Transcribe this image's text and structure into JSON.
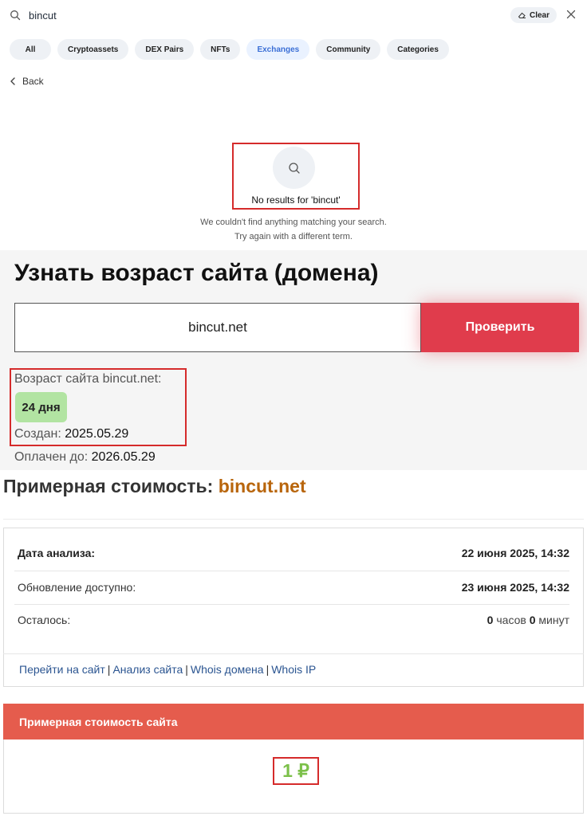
{
  "search": {
    "query": "bincut",
    "clear_label": "Clear"
  },
  "tabs": [
    {
      "label": "All"
    },
    {
      "label": "Cryptoassets"
    },
    {
      "label": "DEX Pairs"
    },
    {
      "label": "NFTs"
    },
    {
      "label": "Exchanges",
      "active": true
    },
    {
      "label": "Community"
    },
    {
      "label": "Categories"
    }
  ],
  "back_label": "Back",
  "no_results": {
    "title": "No results for 'bincut'",
    "line1": "We couldn't find anything matching your search.",
    "line2": "Try again with a different term."
  },
  "domain_age": {
    "heading": "Узнать возраст сайта (домена)",
    "input_value": "bincut.net",
    "button_label": "Проверить",
    "age_label": "Возраст сайта bincut.net:",
    "age_value": "24 дня",
    "created_label": "Создан:",
    "created_value": "2025.05.29",
    "paid_label": "Оплачен до:",
    "paid_value": "2026.05.29"
  },
  "estimate": {
    "heading_prefix": "Примерная стоимость:",
    "heading_site": "bincut.net",
    "rows": [
      {
        "label": "Дата анализа:",
        "value": "22 июня 2025, 14:32"
      },
      {
        "label": "Обновление доступно:",
        "value": "23 июня 2025, 14:32"
      },
      {
        "label": "Осталось:",
        "hours": "0",
        "hours_unit": "часов",
        "minutes": "0",
        "minutes_unit": "минут"
      }
    ],
    "links": [
      "Перейти на сайт",
      "Анализ сайта",
      "Whois домена",
      "Whois IP"
    ],
    "link_separator": "|",
    "price_header": "Примерная стоимость сайта",
    "price_value": "1 ₽"
  },
  "colors": {
    "accent_red": "#e03c4c",
    "header_red": "#e55c4d",
    "highlight_box": "#d52b2b",
    "age_badge": "#b2e4a2",
    "price_green": "#7cc04a",
    "site_orange": "#b8650c",
    "active_tab_text": "#3b6fd6"
  },
  "icons": {
    "search": "search-icon",
    "clear": "eraser-icon",
    "close": "close-icon",
    "back": "chevron-left-icon",
    "empty_state": "search-icon"
  }
}
